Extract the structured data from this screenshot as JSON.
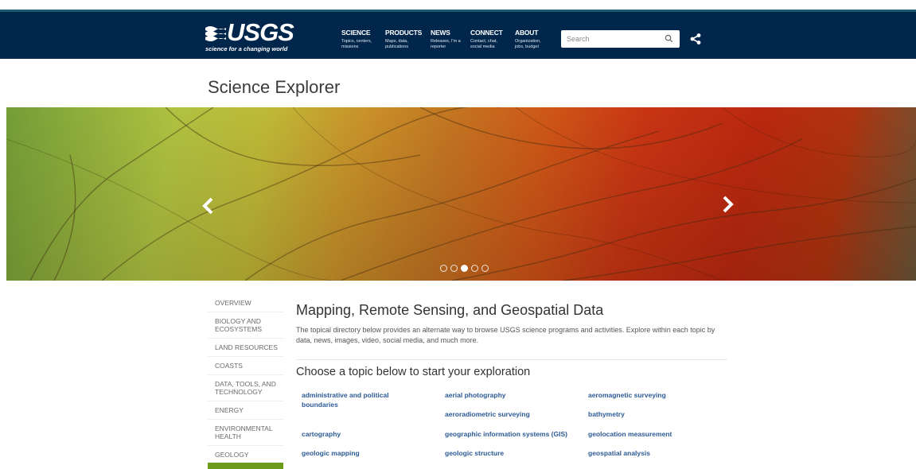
{
  "header": {
    "logo_text": "USGS",
    "logo_tagline": "science for a changing world",
    "nav": [
      {
        "title": "SCIENCE",
        "sub": "Topics, centers, missions"
      },
      {
        "title": "PRODUCTS",
        "sub": "Maps, data, publications"
      },
      {
        "title": "NEWS",
        "sub": "Releases, I'm a reporter"
      },
      {
        "title": "CONNECT",
        "sub": "Contact, chat, social media"
      },
      {
        "title": "ABOUT",
        "sub": "Organization, jobs, budget"
      }
    ],
    "search_placeholder": "Search",
    "search_icon": "search-icon",
    "share_icon": "share-icon"
  },
  "page": {
    "title": "Science Explorer"
  },
  "carousel": {
    "prev_icon": "chevron-left-icon",
    "next_icon": "chevron-right-icon",
    "slide_count": 5,
    "active_slide": 3
  },
  "sidebar": {
    "items": [
      {
        "label": "OVERVIEW"
      },
      {
        "label": "BIOLOGY AND ECOSYSTEMS"
      },
      {
        "label": "LAND RESOURCES"
      },
      {
        "label": "COASTS"
      },
      {
        "label": "DATA, TOOLS, AND TECHNOLOGY"
      },
      {
        "label": "ENERGY"
      },
      {
        "label": "ENVIRONMENTAL HEALTH"
      },
      {
        "label": "GEOLOGY"
      }
    ]
  },
  "main": {
    "title": "Mapping, Remote Sensing, and Geospatial Data",
    "description": "The topical directory below provides an alternate way to browse USGS science programs and activities. Explore within each topic by data, news, images, video, social media, and much more.",
    "choose_heading": "Choose a topic below to start your exploration",
    "topics": [
      {
        "label": "administrative and political boundaries"
      },
      {
        "label": "aerial photography"
      },
      {
        "label": "aeromagnetic surveying"
      },
      {
        "label": "aeroradiometric surveying"
      },
      {
        "label": "bathymetry"
      },
      {
        "label": "cartography"
      },
      {
        "label": "geographic information systems (GIS)"
      },
      {
        "label": "geolocation measurement"
      },
      {
        "label": "geologic mapping"
      },
      {
        "label": "geologic structure"
      },
      {
        "label": "geospatial analysis"
      }
    ]
  },
  "colors": {
    "header_bg": "#00264c",
    "accent_green": "#6d9c1c",
    "link_blue": "#2c5a95"
  }
}
